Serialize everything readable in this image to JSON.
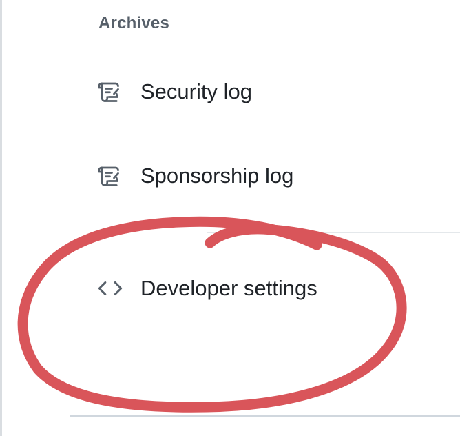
{
  "sidebar": {
    "section_heading": "Archives",
    "items": [
      {
        "label": "Security log",
        "icon": "log-icon"
      },
      {
        "label": "Sponsorship log",
        "icon": "log-icon"
      },
      {
        "label": "Developer settings",
        "icon": "code-icon"
      }
    ]
  },
  "annotation": {
    "color": "#d9555a"
  }
}
